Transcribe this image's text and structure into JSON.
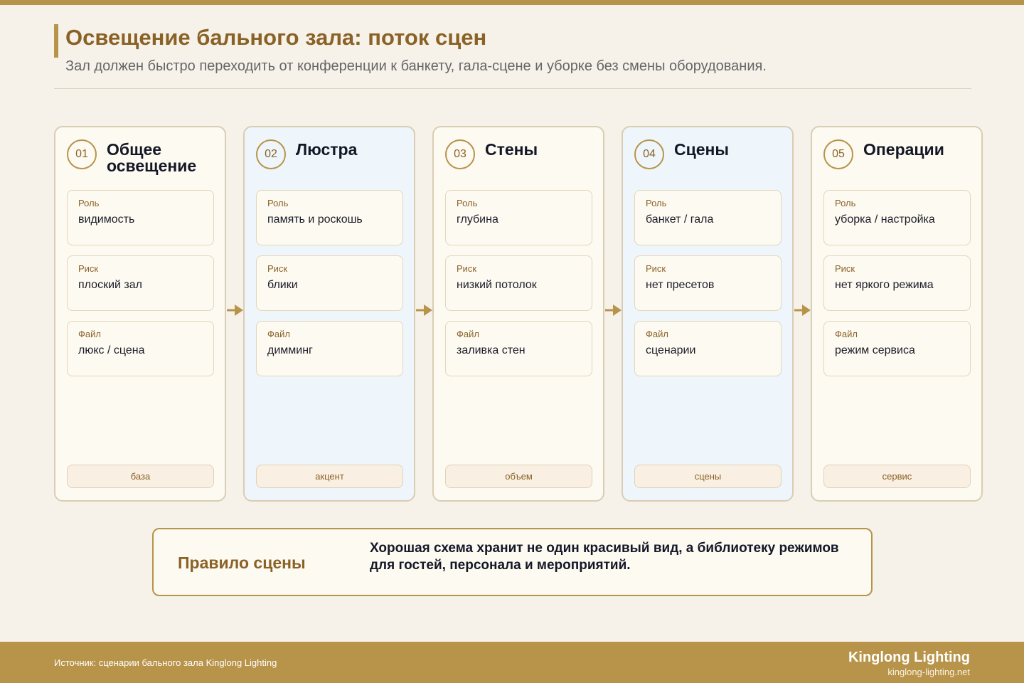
{
  "header": {
    "title": "Освещение бального зала: поток сцен",
    "subtitle": "Зал должен быстро переходить от конференции к банкету, гала-сцене и уборке без смены оборудования."
  },
  "columns": [
    {
      "number": "01",
      "title": "Общее освещение",
      "rows": [
        {
          "label": "Роль",
          "value": "видимость"
        },
        {
          "label": "Риск",
          "value": "плоский зал"
        },
        {
          "label": "Файл",
          "value": "люкс / сцена"
        }
      ],
      "tag": "база"
    },
    {
      "number": "02",
      "title": "Люстра",
      "rows": [
        {
          "label": "Роль",
          "value": "память и роскошь"
        },
        {
          "label": "Риск",
          "value": "блики"
        },
        {
          "label": "Файл",
          "value": "димминг"
        }
      ],
      "tag": "акцент"
    },
    {
      "number": "03",
      "title": "Стены",
      "rows": [
        {
          "label": "Роль",
          "value": "глубина"
        },
        {
          "label": "Риск",
          "value": "низкий потолок"
        },
        {
          "label": "Файл",
          "value": "заливка стен"
        }
      ],
      "tag": "объем"
    },
    {
      "number": "04",
      "title": "Сцены",
      "rows": [
        {
          "label": "Роль",
          "value": "банкет / гала"
        },
        {
          "label": "Риск",
          "value": "нет пресетов"
        },
        {
          "label": "Файл",
          "value": "сценарии"
        }
      ],
      "tag": "сцены"
    },
    {
      "number": "05",
      "title": "Операции",
      "rows": [
        {
          "label": "Роль",
          "value": "уборка / настройка"
        },
        {
          "label": "Риск",
          "value": "нет яркого режима"
        },
        {
          "label": "Файл",
          "value": "режим сервиса"
        }
      ],
      "tag": "сервис"
    }
  ],
  "rule": {
    "title": "Правило сцены",
    "text": "Хорошая схема хранит не один красивый вид, а библиотеку режимов для гостей, персонала и мероприятий."
  },
  "footer": {
    "source": "Источник: сценарии бального зала Kinglong Lighting",
    "brand": "Kinglong Lighting",
    "site": "kinglong-lighting.net"
  },
  "colors": {
    "accent": "#b8944a",
    "title": "#8a6226",
    "background": "#f6f2ea",
    "column_alt": "#eef6fb"
  }
}
